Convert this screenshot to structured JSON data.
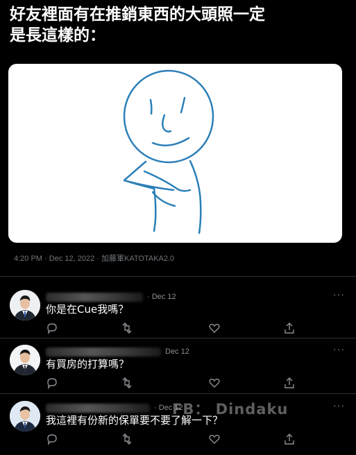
{
  "headline": {
    "line1": "好友裡面有在推銷東西的大頭照一定",
    "line2": "是長這樣的："
  },
  "tweet": {
    "time": "4:20 PM",
    "date": "Dec 12, 2022",
    "author": "加藤軍KATOTAKA2.0"
  },
  "replies": [
    {
      "date": "Dec 12",
      "text": "你是在Cue我嗎？"
    },
    {
      "date": "Dec 12",
      "text": "有買房的打算嗎？"
    },
    {
      "date": "Dec 12",
      "text": "我這裡有份新的保單要不要了解一下？"
    }
  ],
  "more_label": "···",
  "watermark": "FB： Dindaku",
  "icons": [
    "reply-icon",
    "retweet-icon",
    "like-icon",
    "share-icon"
  ]
}
